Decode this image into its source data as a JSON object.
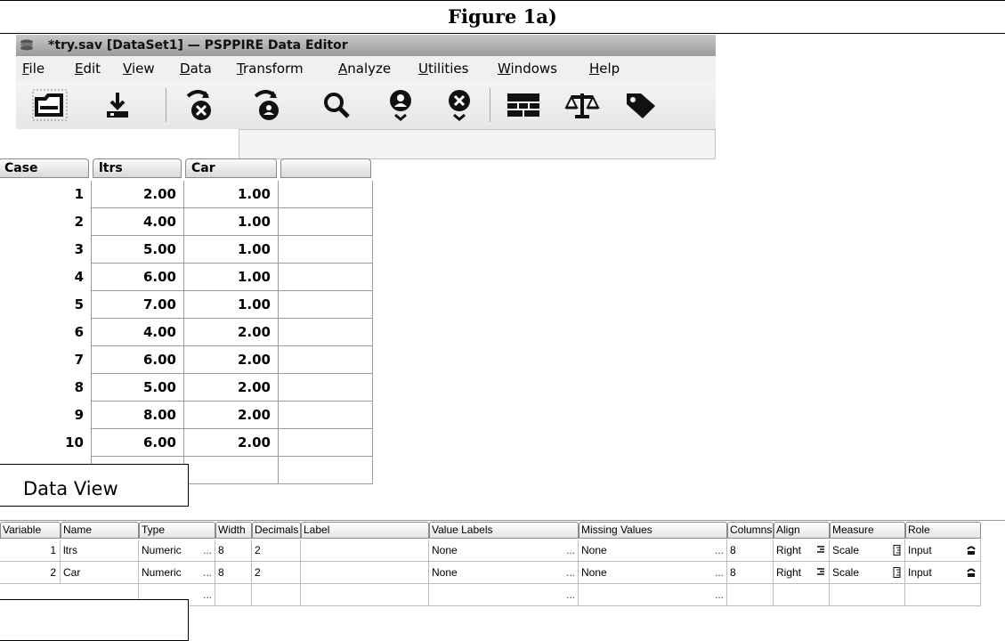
{
  "figure_title": "Figure 1a)",
  "window": {
    "title": "*try.sav [DataSet1] — PSPPIRE Data Editor",
    "icon": "app-stack-icon"
  },
  "menu": [
    {
      "label": "File",
      "underline": "F",
      "rest": "ile"
    },
    {
      "label": "Edit",
      "underline": "E",
      "rest": "dit"
    },
    {
      "label": "View",
      "underline": "V",
      "rest": "iew"
    },
    {
      "label": "Data",
      "underline": "D",
      "rest": "ata"
    },
    {
      "label": "Transform",
      "underline": "T",
      "rest": "ransform"
    },
    {
      "label": "Analyze",
      "underline": "A",
      "rest": "nalyze"
    },
    {
      "label": "Utilities",
      "underline": "U",
      "rest": "tilities"
    },
    {
      "label": "Windows",
      "underline": "W",
      "rest": "indows"
    },
    {
      "label": "Help",
      "underline": "H",
      "rest": "elp"
    }
  ],
  "toolbar": [
    {
      "icon": "open-file-icon"
    },
    {
      "icon": "save-download-icon"
    },
    {
      "icon": "goto-case-icon"
    },
    {
      "icon": "goto-variable-icon"
    },
    {
      "icon": "find-search-icon"
    },
    {
      "icon": "insert-case-icon"
    },
    {
      "icon": "insert-variable-icon"
    },
    {
      "icon": "split-file-icon"
    },
    {
      "icon": "weight-cases-icon"
    },
    {
      "icon": "value-labels-icon"
    }
  ],
  "data_view": {
    "headers": [
      "Case",
      "ltrs",
      "Car",
      ""
    ],
    "rows": [
      {
        "case": "1",
        "ltrs": "2.00",
        "car": "1.00"
      },
      {
        "case": "2",
        "ltrs": "4.00",
        "car": "1.00"
      },
      {
        "case": "3",
        "ltrs": "5.00",
        "car": "1.00"
      },
      {
        "case": "4",
        "ltrs": "6.00",
        "car": "1.00"
      },
      {
        "case": "5",
        "ltrs": "7.00",
        "car": "1.00"
      },
      {
        "case": "6",
        "ltrs": "4.00",
        "car": "2.00"
      },
      {
        "case": "7",
        "ltrs": "6.00",
        "car": "2.00"
      },
      {
        "case": "8",
        "ltrs": "5.00",
        "car": "2.00"
      },
      {
        "case": "9",
        "ltrs": "8.00",
        "car": "2.00"
      },
      {
        "case": "10",
        "ltrs": "6.00",
        "car": "2.00"
      }
    ],
    "tab_label": "Data View"
  },
  "variable_view": {
    "headers": [
      "Variable",
      "Name",
      "Type",
      "Width",
      "Decimals",
      "Label",
      "Value Labels",
      "Missing Values",
      "Columns",
      "Align",
      "Measure",
      "Role"
    ],
    "rows": [
      {
        "num": "1",
        "name": "ltrs",
        "type": "Numeric",
        "width": "8",
        "decimals": "2",
        "label": "",
        "value_labels": "None",
        "missing": "None",
        "columns": "8",
        "align": "Right",
        "measure": "Scale",
        "role": "Input"
      },
      {
        "num": "2",
        "name": "Car",
        "type": "Numeric",
        "width": "8",
        "decimals": "2",
        "label": "",
        "value_labels": "None",
        "missing": "None",
        "columns": "8",
        "align": "Right",
        "measure": "Scale",
        "role": "Input"
      }
    ],
    "ellipsis": "..."
  }
}
